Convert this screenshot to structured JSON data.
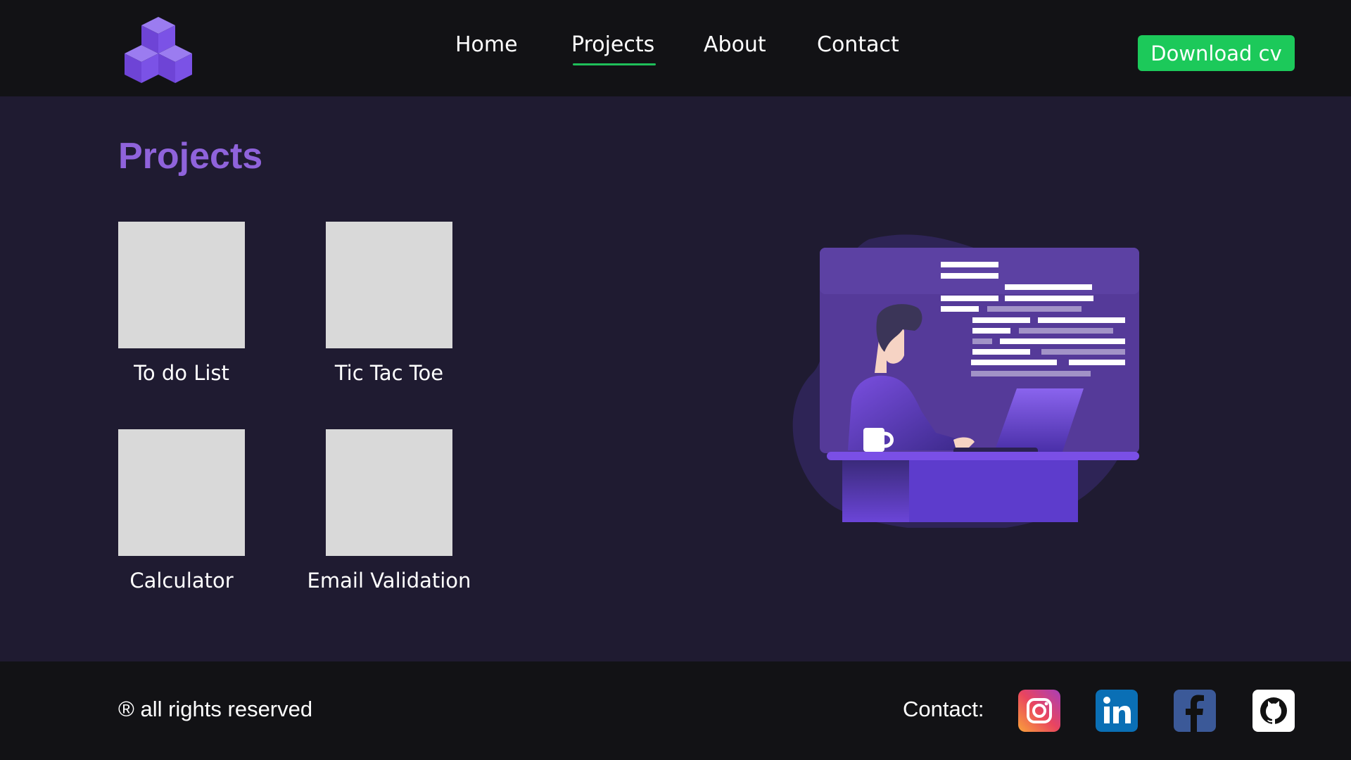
{
  "header": {
    "nav": [
      {
        "label": "Home"
      },
      {
        "label": "Projects"
      },
      {
        "label": "About"
      },
      {
        "label": "Contact"
      }
    ],
    "active_nav": "Projects",
    "download_label": "Download cv",
    "logo_icon": "cubes-logo-icon"
  },
  "main": {
    "title": "Projects",
    "projects": [
      {
        "label": "To do List"
      },
      {
        "label": "Tic Tac Toe"
      },
      {
        "label": "Calculator"
      },
      {
        "label": "Email Validation"
      }
    ],
    "illustration_icon": "developer-at-desk-illustration"
  },
  "footer": {
    "rights": "® all rights reserved",
    "contact_label": "Contact:",
    "social": [
      {
        "icon": "instagram-icon"
      },
      {
        "icon": "linkedin-icon"
      },
      {
        "icon": "facebook-icon"
      },
      {
        "icon": "github-icon"
      }
    ]
  },
  "colors": {
    "background": "#1f1b31",
    "header_footer": "#121215",
    "accent_purple": "#8f63db",
    "download_green": "#1cc95a",
    "thumbnail": "#d9d9d9"
  }
}
